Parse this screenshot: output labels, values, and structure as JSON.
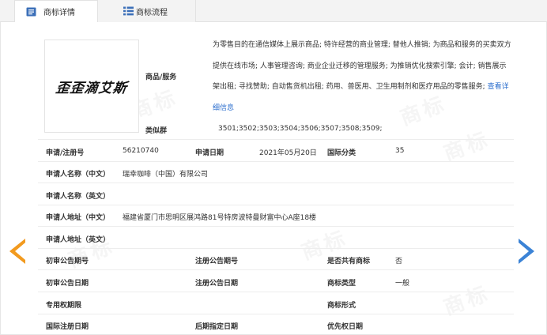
{
  "tabs": [
    {
      "label": "商标详情",
      "icon": "document-icon",
      "active": true
    },
    {
      "label": "商标流程",
      "icon": "list-icon",
      "active": false
    }
  ],
  "logo": {
    "text": "歪歪滴艾斯"
  },
  "goods": {
    "label": "商品/服务",
    "text": "为零售目的在通信媒体上展示商品; 特许经营的商业管理; 替他人推销; 为商品和服务的买卖双方提供在线市场; 人事管理咨询; 商业企业迁移的管理服务; 为推销优化搜索引擎; 会计; 销售展示架出租; 寻找赞助; 自动售货机出租; 药用、兽医用、卫生用制剂和医疗用品的零售服务;",
    "link": "查看详细信息"
  },
  "similar_group": {
    "label": "类似群",
    "value": "3501;3502;3503;3504;3506;3507;3508;3509;"
  },
  "fields": {
    "reg_no": {
      "label": "申请/注册号",
      "value": "56210740"
    },
    "app_date": {
      "label": "申请日期",
      "value": "2021年05月20日"
    },
    "intl_class": {
      "label": "国际分类",
      "value": "35"
    },
    "applicant_cn": {
      "label": "申请人名称（中文）",
      "value": "瑞幸咖啡（中国）有限公司"
    },
    "applicant_en": {
      "label": "申请人名称（英文）",
      "value": ""
    },
    "address_cn": {
      "label": "申请人地址（中文）",
      "value": "福建省厦门市思明区展鸿路81号特房波特曼财富中心A座18楼"
    },
    "address_en": {
      "label": "申请人地址（英文）",
      "value": ""
    },
    "prelim_no": {
      "label": "初审公告期号",
      "value": ""
    },
    "reg_notice_no": {
      "label": "注册公告期号",
      "value": ""
    },
    "shared": {
      "label": "是否共有商标",
      "value": "否"
    },
    "prelim_date": {
      "label": "初审公告日期",
      "value": ""
    },
    "reg_notice_date": {
      "label": "注册公告日期",
      "value": ""
    },
    "tm_type": {
      "label": "商标类型",
      "value": "一般"
    },
    "exclusive_period": {
      "label": "专用权期限",
      "value": ""
    },
    "tm_form": {
      "label": "商标形式",
      "value": ""
    },
    "intl_reg_date": {
      "label": "国际注册日期",
      "value": ""
    },
    "later_date": {
      "label": "后期指定日期",
      "value": ""
    },
    "priority_date": {
      "label": "优先权日期",
      "value": ""
    }
  },
  "watermark": "商标",
  "colors": {
    "link": "#2d6fce",
    "arrow_left": "#f29a1e",
    "arrow_right": "#3b83d6"
  }
}
